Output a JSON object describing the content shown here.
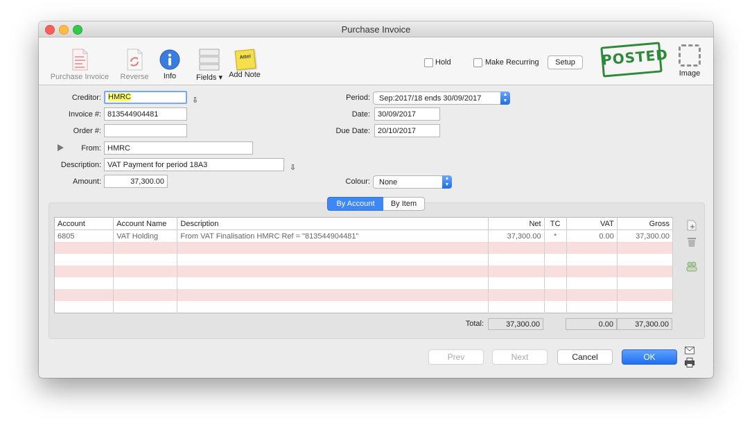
{
  "window": {
    "title": "Purchase Invoice"
  },
  "toolbar": {
    "purchase_invoice": "Purchase Invoice",
    "reverse": "Reverse",
    "info": "Info",
    "fields": "Fields",
    "add_note": "Add Note",
    "note_sticker": "Attn!",
    "hold": "Hold",
    "make_recurring": "Make Recurring",
    "setup": "Setup",
    "posted_stamp": "POSTED",
    "image": "Image"
  },
  "form": {
    "creditor_label": "Creditor:",
    "creditor_value": "HMRC",
    "invoice_label": "Invoice #:",
    "invoice_value": "813544904481",
    "order_label": "Order #:",
    "order_value": "",
    "from_label": "From:",
    "from_value": "HMRC",
    "description_label": "Description:",
    "description_value": "VAT Payment for period 18A3",
    "amount_label": "Amount:",
    "amount_value": "37,300.00",
    "period_label": "Period:",
    "period_value": "Sep:2017/18 ends 30/09/2017",
    "date_label": "Date:",
    "date_value": "30/09/2017",
    "due_date_label": "Due Date:",
    "due_date_value": "20/10/2017",
    "colour_label": "Colour:",
    "colour_value": "None"
  },
  "tabs": {
    "by_account": "By Account",
    "by_item": "By Item"
  },
  "table": {
    "headers": {
      "account": "Account",
      "account_name": "Account Name",
      "description": "Description",
      "net": "Net",
      "tc": "TC",
      "vat": "VAT",
      "gross": "Gross"
    },
    "rows": [
      {
        "account": "6805",
        "account_name": "VAT Holding",
        "description": "From VAT Finalisation HMRC Ref = \"813544904481\"",
        "net": "37,300.00",
        "tc": "*",
        "vat": "0.00",
        "gross": "37,300.00"
      }
    ],
    "totals": {
      "label": "Total:",
      "net": "37,300.00",
      "vat": "0.00",
      "gross": "37,300.00"
    }
  },
  "buttons": {
    "prev": "Prev",
    "next": "Next",
    "cancel": "Cancel",
    "ok": "OK"
  },
  "colors": {
    "accent": "#2f7cf6",
    "posted_green": "#2e8a3a",
    "row_pink": "#f9dede",
    "highlight": "#ffff66"
  }
}
